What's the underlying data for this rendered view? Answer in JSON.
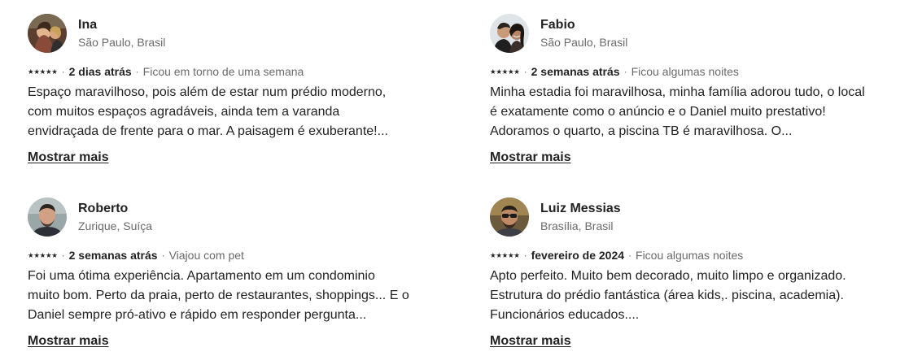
{
  "reviews": [
    {
      "name": "Ina",
      "location": "São Paulo, Brasil",
      "stars": "★★★★★",
      "date": "2 dias atrás",
      "stay": "Ficou em torno de uma semana",
      "text": "Espaço maravilhoso, pois além de estar num prédio moderno, com muitos espaços agradáveis, ainda tem a varanda envidraçada de frente para o mar. A paisagem é exuberante!...",
      "more_label": "Mostrar mais"
    },
    {
      "name": "Fabio",
      "location": "São Paulo, Brasil",
      "stars": "★★★★★",
      "date": "2 semanas atrás",
      "stay": "Ficou algumas noites",
      "text": "Minha estadia foi maravilhosa, minha família adorou tudo, o local é exatamente como o anúncio e o Daniel muito prestativo! Adoramos o quarto, a piscina TB é maravilhosa. O...",
      "more_label": "Mostrar mais"
    },
    {
      "name": "Roberto",
      "location": "Zurique, Suíça",
      "stars": "★★★★★",
      "date": "2 semanas atrás",
      "stay": "Viajou com pet",
      "text": "Foi uma ótima experiência. Apartamento em um condominio muito bom. Perto da praia, perto de restaurantes, shoppings... E o Daniel sempre pró-ativo e rápido em responder pergunta...",
      "more_label": "Mostrar mais"
    },
    {
      "name": "Luiz Messias",
      "location": "Brasília, Brasil",
      "stars": "★★★★★",
      "date": "fevereiro de 2024",
      "stay": "Ficou algumas noites",
      "text": "Apto perfeito. Muito bem decorado, muito limpo e organizado. Estrutura do prédio fantástica (área kids,. piscina, academia). Funcionários educados....",
      "more_label": "Mostrar mais"
    }
  ]
}
